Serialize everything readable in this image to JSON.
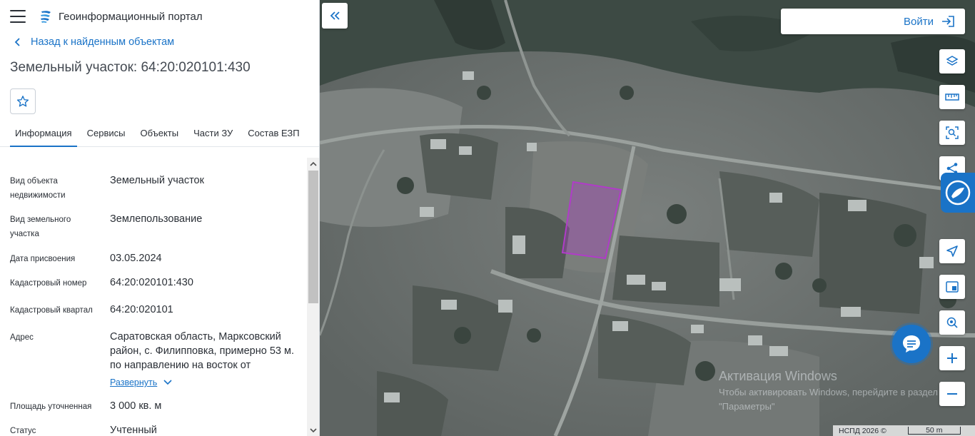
{
  "header": {
    "title": "Геоинформационный портал",
    "menu_icon": "hamburger-menu-icon",
    "logo_icon": "portal-logo-icon"
  },
  "navigation": {
    "back_label": "Назад к найденным объектам"
  },
  "object": {
    "title": "Земельный участок: 64:20:020101:430"
  },
  "tabs": [
    {
      "label": "Информация",
      "active": true
    },
    {
      "label": "Сервисы"
    },
    {
      "label": "Объекты"
    },
    {
      "label": "Части ЗУ"
    },
    {
      "label": "Состав ЕЗП"
    }
  ],
  "details": [
    {
      "label": "Вид объекта недвижимости",
      "value": "Земельный участок"
    },
    {
      "label": "Вид земельного участка",
      "value": "Землепользование"
    },
    {
      "label": "Дата присвоения",
      "value": "03.05.2024"
    },
    {
      "label": "Кадастровый номер",
      "value": "64:20:020101:430"
    },
    {
      "label": "Кадастровый квартал",
      "value": "64:20:020101"
    },
    {
      "label": "Адрес",
      "value": "Саратовская область, Марксовский район, с. Филипповка, примерно 53 м. по направлению на восток от",
      "expand_label": "Развернуть"
    },
    {
      "label": "Площадь уточненная",
      "value": "3 000 кв. м"
    },
    {
      "label": "Статус",
      "value": "Учтенный"
    }
  ],
  "map": {
    "login_label": "Войти",
    "tools": [
      "layers-icon",
      "ruler-icon",
      "area-search-icon",
      "share-icon",
      "locate-icon",
      "minimap-icon",
      "geo-marker-icon",
      "zoom-in-icon",
      "zoom-out-icon"
    ],
    "watermark_title": "Активация Windows",
    "watermark_text": "Чтобы активировать Windows, перейдите в раздел \"Параметры\"",
    "attribution": "НСПД 2026 ©",
    "scale_label": "50 m",
    "parcel_color": "#b03cc8"
  },
  "colors": {
    "accent": "#1a73c7"
  }
}
